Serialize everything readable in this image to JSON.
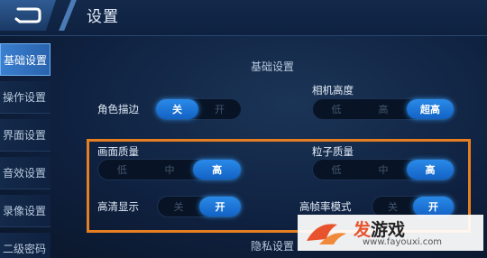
{
  "header": {
    "title": "设置"
  },
  "sidebar": {
    "items": [
      {
        "label": "基础设置",
        "active": true
      },
      {
        "label": "操作设置",
        "active": false
      },
      {
        "label": "界面设置",
        "active": false
      },
      {
        "label": "音效设置",
        "active": false
      },
      {
        "label": "录像设置",
        "active": false
      },
      {
        "label": "二级密码",
        "active": false
      }
    ]
  },
  "content": {
    "section_title": "基础设置",
    "section_title_bottom": "隐私设置",
    "settings": {
      "role_outline": {
        "label": "角色描边",
        "options": [
          "关",
          "开"
        ],
        "selected": "关"
      },
      "camera_height": {
        "label": "相机高度",
        "options": [
          "低",
          "高",
          "超高"
        ],
        "selected": "超高"
      },
      "image_quality": {
        "label": "画面质量",
        "options": [
          "低",
          "中",
          "高"
        ],
        "selected": "高"
      },
      "particle_quality": {
        "label": "粒子质量",
        "options": [
          "低",
          "中",
          "高"
        ],
        "selected": "高"
      },
      "hd_display": {
        "label": "高清显示",
        "options": [
          "关",
          "开"
        ],
        "selected": "开"
      },
      "high_fps_mode": {
        "label": "高帧率模式",
        "options": [
          "关",
          "开"
        ],
        "selected": "开"
      }
    }
  },
  "watermark": {
    "logo_prefix": "发",
    "logo_suffix": "游戏",
    "url": "www.fayouxi.com"
  },
  "colors": {
    "accent": "#2a8ae8",
    "highlight_box": "#e67e22",
    "background": "#0f2140"
  }
}
